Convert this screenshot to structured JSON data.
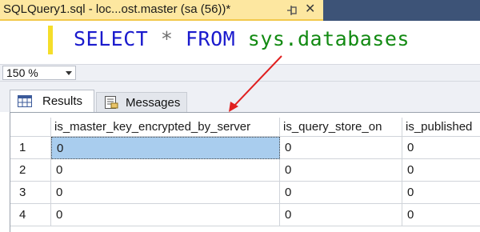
{
  "document_tab": {
    "title": "SQLQuery1.sql - loc...ost.master (sa (56))*",
    "close_glyph": "✕"
  },
  "editor": {
    "keyword_select": "SELECT",
    "operator_star": "*",
    "keyword_from": "FROM",
    "object_name": "sys.databases"
  },
  "zoom": {
    "value": "150 %"
  },
  "results_tabs": [
    {
      "label": "Results",
      "icon": "grid-icon"
    },
    {
      "label": "Messages",
      "icon": "messages-icon"
    }
  ],
  "grid": {
    "columns": [
      "is_master_key_encrypted_by_server",
      "is_query_store_on",
      "is_published"
    ],
    "rows": [
      {
        "num": "1",
        "values": [
          "0",
          "0",
          "0"
        ]
      },
      {
        "num": "2",
        "values": [
          "0",
          "0",
          "0"
        ]
      },
      {
        "num": "3",
        "values": [
          "0",
          "0",
          "0"
        ]
      },
      {
        "num": "4",
        "values": [
          "0",
          "0",
          "0"
        ]
      }
    ]
  },
  "colors": {
    "tab_active": "#fde7a0",
    "tabstrip_bg": "#3a4f6f",
    "keyword": "#1a1acd",
    "object": "#128a12",
    "selection": "#a9cdee",
    "annotation_arrow": "#e02020"
  }
}
